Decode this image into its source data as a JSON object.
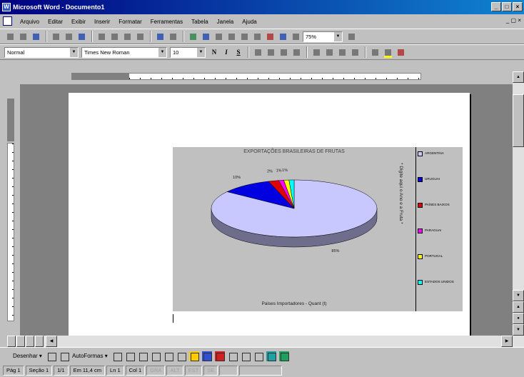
{
  "window": {
    "title": "Microsoft Word - Documento1",
    "controls": [
      "_",
      "□",
      "×"
    ]
  },
  "menu": {
    "items": [
      "Arquivo",
      "Editar",
      "Exibir",
      "Inserir",
      "Formatar",
      "Ferramentas",
      "Tabela",
      "Janela",
      "Ajuda"
    ],
    "doc_controls": "_ ▢ ×"
  },
  "standard_toolbar": {
    "zoom": "75%"
  },
  "format_toolbar": {
    "style": "Normal",
    "font": "Times New Roman",
    "size": "10"
  },
  "draw_toolbar": {
    "draw_label": "Desenhar ▾",
    "autoshapes_label": "AutoFormas ▾"
  },
  "status": {
    "page": "Pág 1",
    "section": "Seção 1",
    "pages": "1/1",
    "position": "Em 11,4 cm",
    "line": "Ln 1",
    "column": "Col 1",
    "modes": [
      "GRA",
      "ALT",
      "EST",
      "SE"
    ],
    "lang": ""
  },
  "chart_data": {
    "type": "pie",
    "title": "EXPORTAÇÕES BRASILEIRAS DE FRUTAS",
    "ylabel": "* Digite aqui o Ano e a Fruta *",
    "xlabel": "Paises Importadores - Quant (t)",
    "categories": [
      "ARGENTINA",
      "URUGUAI",
      "PAÍSES BAIXOS",
      "PARAGUAI",
      "PORTUGAL",
      "ESTADOS UNIDOS"
    ],
    "values": [
      85,
      10,
      2,
      1,
      1,
      1
    ],
    "data_labels": [
      "85%",
      "10%",
      "2%",
      "1%",
      "1%",
      ""
    ],
    "colors": [
      "#c8c8ff",
      "#0000e0",
      "#e00000",
      "#ff00ff",
      "#ffff00",
      "#00ffff"
    ],
    "legend_position": "right",
    "three_d": true
  }
}
